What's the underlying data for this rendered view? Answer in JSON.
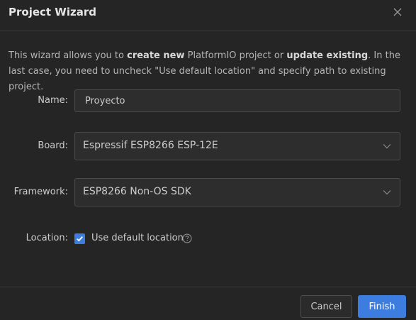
{
  "dialog": {
    "title": "Project Wizard",
    "close_icon": "close-icon"
  },
  "description": {
    "part1": "This wizard allows you to ",
    "bold1": "create new",
    "part2": " PlatformIO project or ",
    "bold2": "update existing",
    "part3": ". In the last case, you need to uncheck \"Use default location\" and specify path to existing project."
  },
  "form": {
    "name": {
      "label": "Name:",
      "value": "Proyecto"
    },
    "board": {
      "label": "Board:",
      "value": "Espressif ESP8266 ESP-12E",
      "icon": "chevron-down-icon"
    },
    "framework": {
      "label": "Framework:",
      "value": "ESP8266 Non-OS SDK",
      "icon": "chevron-down-icon"
    },
    "location": {
      "label": "Location:",
      "checkbox_label": "Use default location",
      "checked": true,
      "help_icon": "help-circle-icon"
    }
  },
  "footer": {
    "cancel_label": "Cancel",
    "finish_label": "Finish"
  },
  "colors": {
    "background": "#252526",
    "accent": "#3d7de0",
    "field_bg": "#2d2d2d",
    "border": "#4a4a4a"
  }
}
